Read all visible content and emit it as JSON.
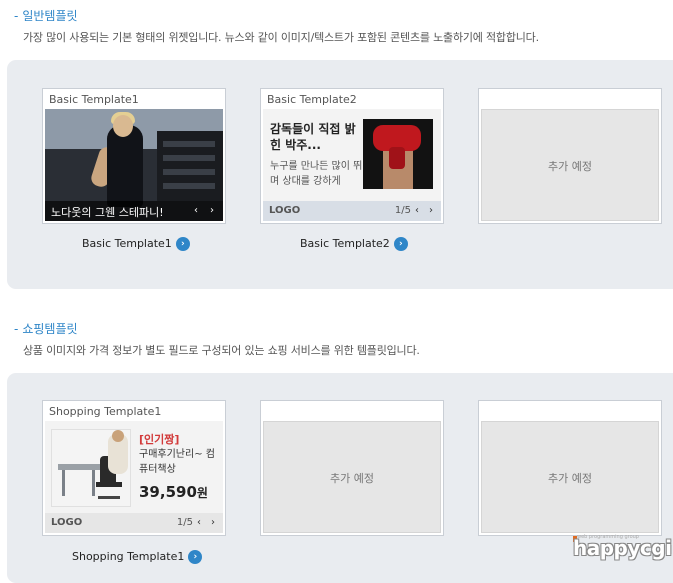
{
  "sections": [
    {
      "title": "일반템플릿",
      "description": "가장 많이 사용되는 기본 형태의 위젯입니다. 뉴스와 같이 이미지/텍스트가 포함된 콘텐츠를 노출하기에 적합합니다."
    },
    {
      "title": "쇼핑템플릿",
      "description": "상품 이미지와 가격 정보가 별도 필드로 구성되어 있는 쇼핑 서비스를 위한 템플릿입니다."
    }
  ],
  "dash": "-",
  "basic1": {
    "card_title": "Basic Template1",
    "caption": "노다웃의 그웬 스테파니!",
    "link_label": "Basic Template1"
  },
  "basic2": {
    "card_title": "Basic Template2",
    "headline": "감독들이 직접 밝힌 박주...",
    "summary": "누구를 만나든 많이 뛰며 상대를 강하게",
    "logo": "LOGO",
    "page": "1/5",
    "link_label": "Basic Template2"
  },
  "placeholder_text": "추가 예정",
  "shopping1": {
    "card_title": "Shopping Template1",
    "tag": "[인기짱]",
    "product_name": "구매후기난리~ 컴퓨터책상",
    "price": "39,590",
    "currency": "원",
    "logo": "LOGO",
    "page": "1/5",
    "link_label": "Shopping Template1"
  },
  "icons": {
    "prev": "‹",
    "next": "›",
    "go": "›"
  },
  "watermark": {
    "small": "web programming group",
    "text": "happycgi"
  },
  "colors": {
    "accent": "#2f86c8",
    "panel": "#e9ecf0",
    "price_tag": "#d23a3a"
  }
}
